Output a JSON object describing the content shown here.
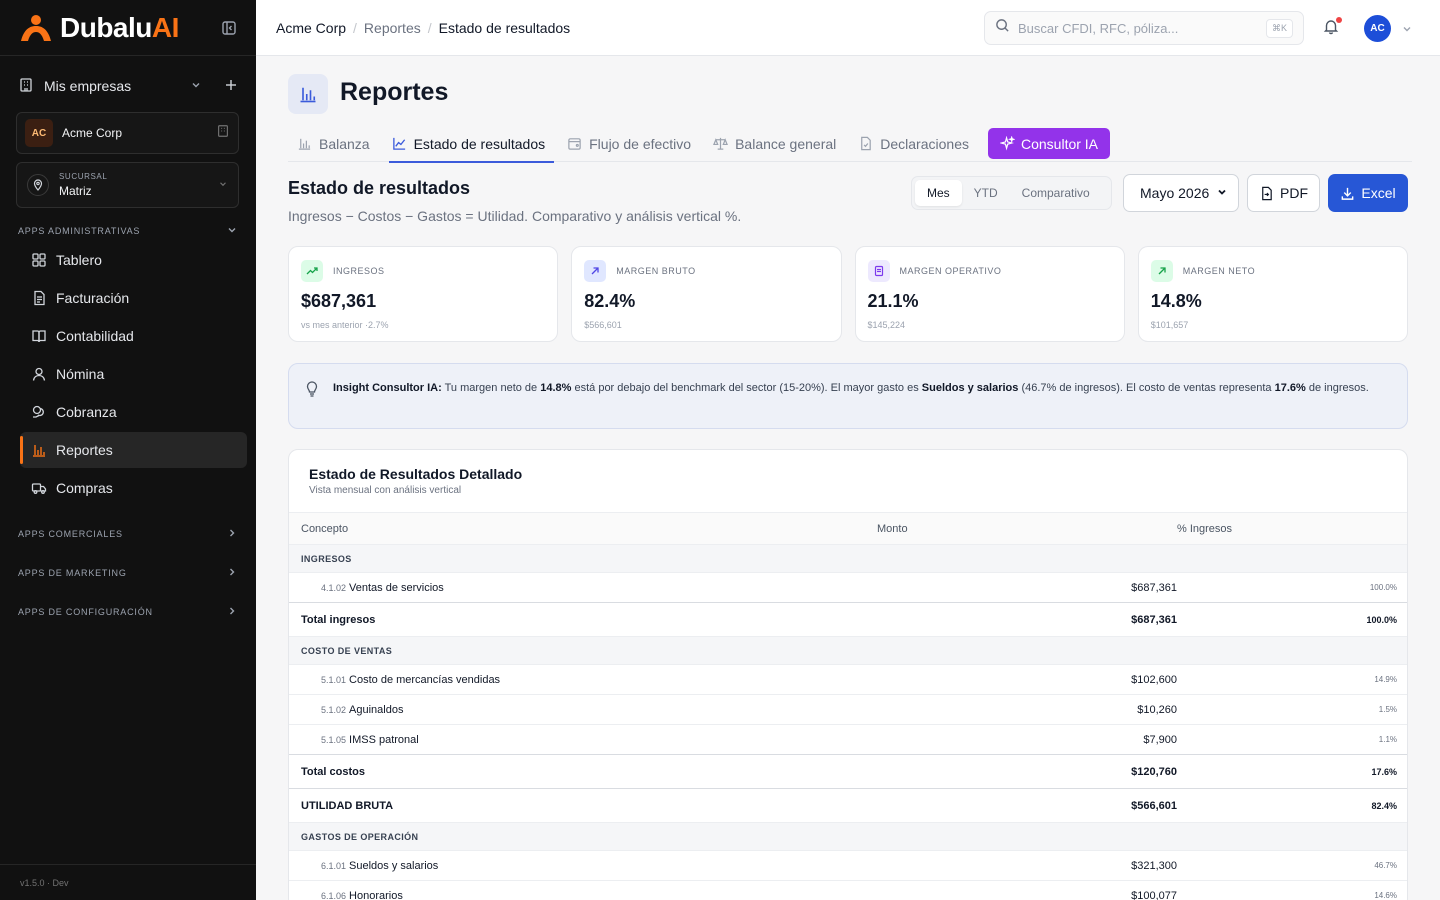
{
  "app": {
    "logo_main": "Dubalu",
    "logo_accent": "AI",
    "version": "v1.5.0 · Dev"
  },
  "colors": {
    "accent": "#f97316",
    "primary": "#2757d6",
    "ai": "#9333ea",
    "sidebar_bg": "#111111"
  },
  "sidebar": {
    "empresas_label": "Mis empresas",
    "company": {
      "initials": "AC",
      "name": "Acme Corp"
    },
    "sucursal": {
      "label": "SUCURSAL",
      "value": "Matriz"
    },
    "sections": {
      "admin": "APPS ADMINISTRATIVAS",
      "comerciales": "APPS COMERCIALES",
      "marketing": "APPS DE MARKETING",
      "config": "APPS DE CONFIGURACIÓN"
    },
    "items": [
      {
        "label": "Tablero",
        "icon": "grid-icon"
      },
      {
        "label": "Facturación",
        "icon": "invoice-icon"
      },
      {
        "label": "Contabilidad",
        "icon": "book-icon"
      },
      {
        "label": "Nómina",
        "icon": "person-icon"
      },
      {
        "label": "Cobranza",
        "icon": "coins-icon"
      },
      {
        "label": "Reportes",
        "icon": "bar-chart-icon",
        "active": true
      },
      {
        "label": "Compras",
        "icon": "truck-icon"
      }
    ]
  },
  "topbar": {
    "breadcrumb": [
      "Acme Corp",
      "Reportes",
      "Estado de resultados"
    ],
    "search_placeholder": "Buscar CFDI, RFC, póliza...",
    "search_shortcut": "⌘K",
    "user_initials": "AC"
  },
  "page": {
    "title": "Reportes",
    "tabs": [
      {
        "label": "Balanza",
        "icon": "bar-chart-icon"
      },
      {
        "label": "Estado de resultados",
        "icon": "line-chart-icon",
        "active": true
      },
      {
        "label": "Flujo de efectivo",
        "icon": "wallet-icon"
      },
      {
        "label": "Balance general",
        "icon": "scale-icon"
      },
      {
        "label": "Declaraciones",
        "icon": "document-icon"
      }
    ],
    "ai_tab": "Consultor IA"
  },
  "report": {
    "title": "Estado de resultados",
    "subtitle": "Ingresos − Costos − Gastos = Utilidad. Comparativo y análisis vertical %.",
    "segments": [
      "Mes",
      "YTD",
      "Comparativo"
    ],
    "active_segment": "Mes",
    "period": "Mayo 2026",
    "period_options": [
      "Mayo 2026"
    ],
    "pdf_label": "PDF",
    "excel_label": "Excel"
  },
  "kpis": [
    {
      "label": "INGRESOS",
      "value": "$687,361",
      "sub": "vs mes anterior ·2.7%",
      "icon": "trend-up-icon",
      "tint": "#dcfce7",
      "color": "#16a34a"
    },
    {
      "label": "MARGEN BRUTO",
      "value": "82.4%",
      "sub": "$566,601",
      "icon": "arrow-up-right-icon",
      "tint": "#e0e7ff",
      "color": "#4f46e5"
    },
    {
      "label": "MARGEN OPERATIVO",
      "value": "21.1%",
      "sub": "$145,224",
      "icon": "receipt-icon",
      "tint": "#ede9fe",
      "color": "#7c3aed"
    },
    {
      "label": "MARGEN NETO",
      "value": "14.8%",
      "sub": "$101,657",
      "icon": "arrow-up-right-icon",
      "tint": "#dcfce7",
      "color": "#16a34a"
    }
  ],
  "insight": {
    "label": "Insight Consultor IA:",
    "t1": " Tu margen neto de ",
    "b1": "14.8%",
    "t2": " está por debajo del benchmark del sector (15-20%). El mayor gasto es ",
    "b2": "Sueldos y salarios",
    "t3": " (46.7% de ingresos). El costo de ventas representa ",
    "b3": "17.6%",
    "t4": " de ingresos."
  },
  "table": {
    "title": "Estado de Resultados Detallado",
    "subtitle": "Vista mensual con análisis vertical",
    "headers": [
      "Concepto",
      "Monto",
      "% Ingresos"
    ],
    "rows": [
      {
        "type": "grp",
        "label": "INGRESOS"
      },
      {
        "type": "item",
        "code": "4.1.02",
        "label": "Ventas de servicios",
        "amount": "$687,361",
        "pct": "100.0%"
      },
      {
        "type": "total",
        "label": "Total ingresos",
        "amount": "$687,361",
        "pct": "100.0%"
      },
      {
        "type": "grp",
        "label": "COSTO DE VENTAS"
      },
      {
        "type": "item",
        "code": "5.1.01",
        "label": "Costo de mercancías vendidas",
        "amount": "$102,600",
        "pct": "14.9%"
      },
      {
        "type": "item",
        "code": "5.1.02",
        "label": "Aguinaldos",
        "amount": "$10,260",
        "pct": "1.5%"
      },
      {
        "type": "item",
        "code": "5.1.05",
        "label": "IMSS patronal",
        "amount": "$7,900",
        "pct": "1.1%"
      },
      {
        "type": "total",
        "label": "Total costos",
        "amount": "$120,760",
        "pct": "17.6%"
      },
      {
        "type": "total",
        "label": "UTILIDAD BRUTA",
        "amount": "$566,601",
        "pct": "82.4%"
      },
      {
        "type": "grp",
        "label": "GASTOS DE OPERACIÓN"
      },
      {
        "type": "item",
        "code": "6.1.01",
        "label": "Sueldos y salarios",
        "amount": "$321,300",
        "pct": "46.7%"
      },
      {
        "type": "item",
        "code": "6.1.06",
        "label": "Honorarios",
        "amount": "$100,077",
        "pct": "14.6%"
      }
    ]
  }
}
